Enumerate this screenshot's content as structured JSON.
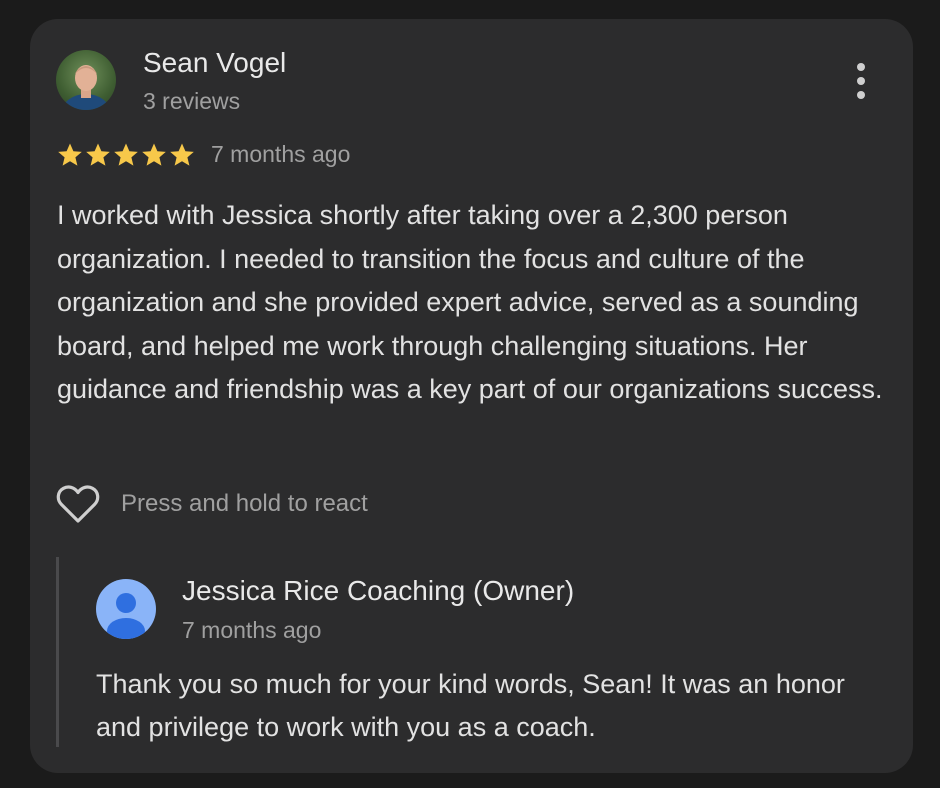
{
  "review": {
    "author": {
      "name": "Sean Vogel",
      "reviews_count": "3 reviews"
    },
    "rating": 5,
    "max_rating": 5,
    "time": "7 months ago",
    "text": "I worked with Jessica shortly after taking over a 2,300 person organization. I needed to transition the focus and culture of the organization and she provided expert advice, served as a sounding board, and helped me work through challenging situations. Her guidance and friendship was a key part of our organizations success.",
    "react_prompt": "Press and hold to react"
  },
  "owner_reply": {
    "name": "Jessica Rice Coaching (Owner)",
    "time": "7 months ago",
    "text": "Thank you so much for your kind words, Sean! It was an honor and privilege to work with you as a coach."
  },
  "icons": {
    "more": "more-vertical-icon",
    "star": "star-icon",
    "react": "heart-outline-icon",
    "owner_avatar": "default-user-icon"
  },
  "colors": {
    "background": "#1b1b1b",
    "card": "#2c2c2d",
    "star": "#f7c84a",
    "primary_text": "#e9e9e9",
    "secondary_text": "#a0a0a0",
    "owner_avatar_bg": "#8ab4f8",
    "owner_avatar_fg": "#2f6fe0"
  }
}
